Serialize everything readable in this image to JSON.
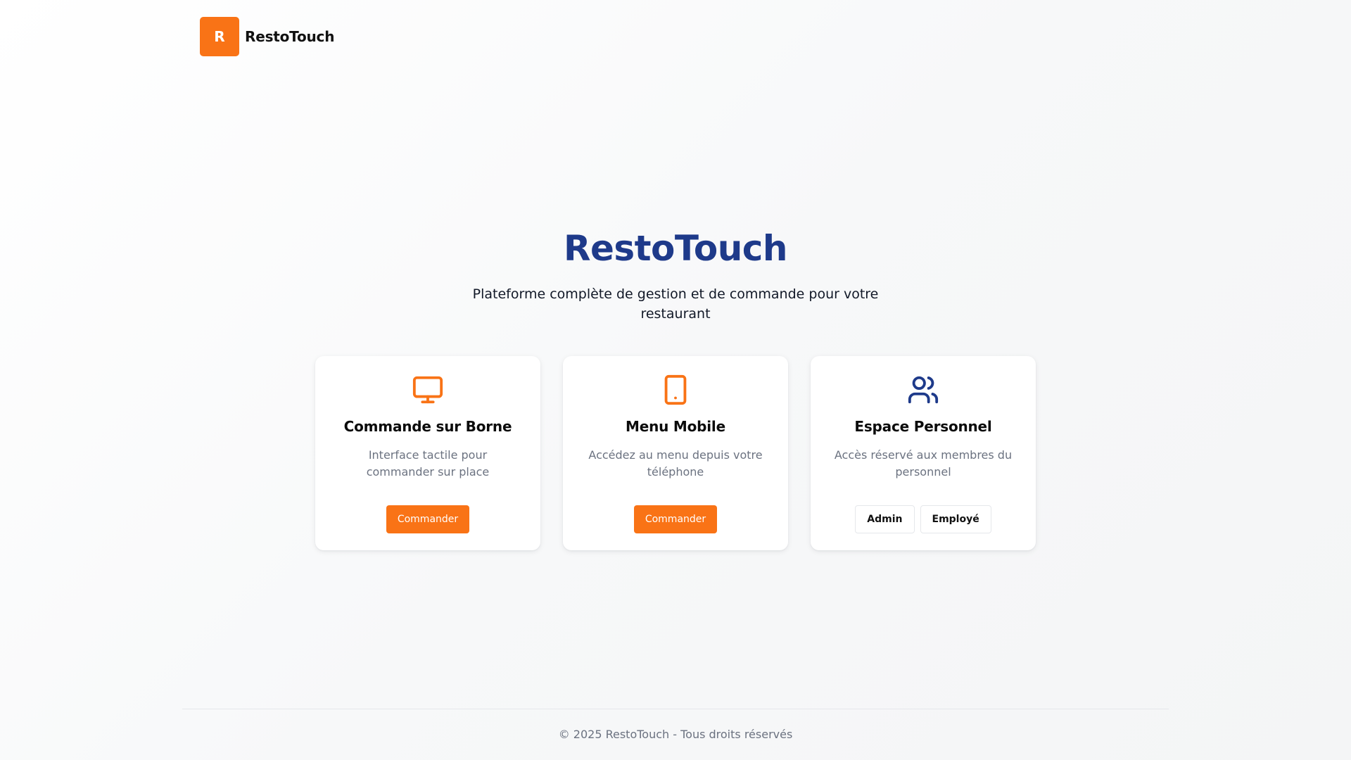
{
  "header": {
    "logo_letter": "R",
    "brand_name": "RestoTouch"
  },
  "hero": {
    "title": "RestoTouch",
    "subtitle": "Plateforme complète de gestion et de commande pour votre restaurant"
  },
  "cards": [
    {
      "icon": "monitor-icon",
      "title": "Commande sur Borne",
      "description": "Interface tactile pour commander sur place",
      "buttons": [
        "Commander"
      ]
    },
    {
      "icon": "tablet-icon",
      "title": "Menu Mobile",
      "description": "Accédez au menu depuis votre téléphone",
      "buttons": [
        "Commander"
      ]
    },
    {
      "icon": "users-icon",
      "title": "Espace Personnel",
      "description": "Accès réservé aux membres du personnel",
      "buttons": [
        "Admin",
        "Employé"
      ]
    }
  ],
  "footer": {
    "text": "© 2025 RestoTouch - Tous droits réservés"
  },
  "colors": {
    "accent": "#f97316",
    "title": "#1e3a8a",
    "muted": "#6b7280"
  }
}
